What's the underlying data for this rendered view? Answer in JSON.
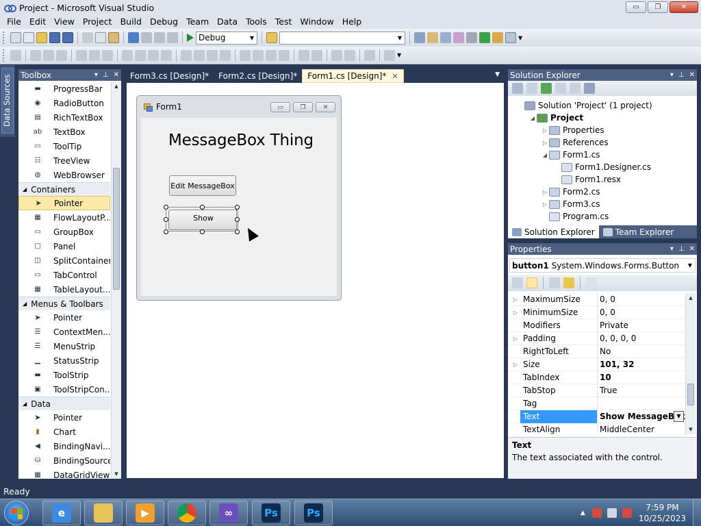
{
  "window": {
    "title": "Project - Microsoft Visual Studio",
    "minimize": "▭",
    "maximize": "❐",
    "close": "✕"
  },
  "menu": [
    "File",
    "Edit",
    "View",
    "Project",
    "Build",
    "Debug",
    "Team",
    "Data",
    "Tools",
    "Test",
    "Window",
    "Help"
  ],
  "toolbar": {
    "config_value": "Debug",
    "platform_value": ""
  },
  "side_strip": {
    "label": "Data Sources"
  },
  "toolbox": {
    "title": "Toolbox",
    "header_controls": [
      "▾",
      "⊥",
      "✕"
    ],
    "common_items_tail": [
      {
        "label": "ProgressBar",
        "icon": "progressbar-icon"
      },
      {
        "label": "RadioButton",
        "icon": "radiobutton-icon"
      },
      {
        "label": "RichTextBox",
        "icon": "richtextbox-icon"
      },
      {
        "label": "TextBox",
        "icon": "textbox-icon"
      },
      {
        "label": "ToolTip",
        "icon": "tooltip-icon"
      },
      {
        "label": "TreeView",
        "icon": "treeview-icon"
      },
      {
        "label": "WebBrowser",
        "icon": "webbrowser-icon"
      }
    ],
    "groups": [
      {
        "title": "Containers",
        "items": [
          {
            "label": "Pointer",
            "icon": "pointer-icon",
            "selected": true
          },
          {
            "label": "FlowLayoutP...",
            "icon": "flowlayoutpanel-icon"
          },
          {
            "label": "GroupBox",
            "icon": "groupbox-icon"
          },
          {
            "label": "Panel",
            "icon": "panel-icon"
          },
          {
            "label": "SplitContainer",
            "icon": "splitcontainer-icon"
          },
          {
            "label": "TabControl",
            "icon": "tabcontrol-icon"
          },
          {
            "label": "TableLayout...",
            "icon": "tablelayoutpanel-icon"
          }
        ]
      },
      {
        "title": "Menus & Toolbars",
        "items": [
          {
            "label": "Pointer",
            "icon": "pointer-icon"
          },
          {
            "label": "ContextMen...",
            "icon": "contextmenu-icon"
          },
          {
            "label": "MenuStrip",
            "icon": "menustrip-icon"
          },
          {
            "label": "StatusStrip",
            "icon": "statusstrip-icon"
          },
          {
            "label": "ToolStrip",
            "icon": "toolstrip-icon"
          },
          {
            "label": "ToolStripCon...",
            "icon": "toolstripcontainer-icon"
          }
        ]
      },
      {
        "title": "Data",
        "items": [
          {
            "label": "Pointer",
            "icon": "pointer-icon"
          },
          {
            "label": "Chart",
            "icon": "chart-icon"
          },
          {
            "label": "BindingNavi...",
            "icon": "bindingnavigator-icon"
          },
          {
            "label": "BindingSource",
            "icon": "bindingsource-icon"
          },
          {
            "label": "DataGridView",
            "icon": "datagridview-icon"
          }
        ]
      }
    ]
  },
  "doc_tabs": [
    {
      "label": "Form3.cs [Design]*",
      "active": false
    },
    {
      "label": "Form2.cs [Design]*",
      "active": false
    },
    {
      "label": "Form1.cs [Design]*",
      "active": true
    }
  ],
  "designer": {
    "form_title": "Form1",
    "heading": "MessageBox Thing",
    "edit_button": "Edit MessageBox",
    "show_button": "Show"
  },
  "solution_explorer": {
    "title": "Solution Explorer",
    "tree": [
      {
        "label": "Solution 'Project' (1 project)",
        "indent": 0,
        "exp": "",
        "bold": false,
        "icon": "solution-icon"
      },
      {
        "label": "Project",
        "indent": 1,
        "exp": "◢",
        "bold": true,
        "icon": "csharp-project-icon"
      },
      {
        "label": "Properties",
        "indent": 2,
        "exp": "▷",
        "bold": false,
        "icon": "properties-folder-icon"
      },
      {
        "label": "References",
        "indent": 2,
        "exp": "▷",
        "bold": false,
        "icon": "references-icon"
      },
      {
        "label": "Form1.cs",
        "indent": 2,
        "exp": "◢",
        "bold": false,
        "icon": "form-file-icon"
      },
      {
        "label": "Form1.Designer.cs",
        "indent": 3,
        "exp": "",
        "bold": false,
        "icon": "cs-file-icon"
      },
      {
        "label": "Form1.resx",
        "indent": 3,
        "exp": "",
        "bold": false,
        "icon": "resx-file-icon"
      },
      {
        "label": "Form2.cs",
        "indent": 2,
        "exp": "▷",
        "bold": false,
        "icon": "form-file-icon"
      },
      {
        "label": "Form3.cs",
        "indent": 2,
        "exp": "▷",
        "bold": false,
        "icon": "form-file-icon"
      },
      {
        "label": "Program.cs",
        "indent": 2,
        "exp": "",
        "bold": false,
        "icon": "cs-file-icon"
      }
    ],
    "tabs": [
      {
        "label": "Solution Explorer",
        "active": true
      },
      {
        "label": "Team Explorer",
        "active": false
      }
    ]
  },
  "properties": {
    "title": "Properties",
    "object_name": "button1",
    "object_type": "System.Windows.Forms.Button",
    "rows": [
      {
        "name": "MaximumSize",
        "value": "0, 0",
        "exp": "▷",
        "bold": false
      },
      {
        "name": "MinimumSize",
        "value": "0, 0",
        "exp": "▷",
        "bold": false
      },
      {
        "name": "Modifiers",
        "value": "Private",
        "exp": "",
        "bold": false
      },
      {
        "name": "Padding",
        "value": "0, 0, 0, 0",
        "exp": "▷",
        "bold": false
      },
      {
        "name": "RightToLeft",
        "value": "No",
        "exp": "",
        "bold": false
      },
      {
        "name": "Size",
        "value": "101, 32",
        "exp": "▷",
        "bold": true
      },
      {
        "name": "TabIndex",
        "value": "10",
        "exp": "",
        "bold": true
      },
      {
        "name": "TabStop",
        "value": "True",
        "exp": "",
        "bold": false
      },
      {
        "name": "Tag",
        "value": "",
        "exp": "",
        "bold": false
      },
      {
        "name": "Text",
        "value": "Show MessageBox",
        "exp": "",
        "bold": true,
        "selected": true
      },
      {
        "name": "TextAlign",
        "value": "MiddleCenter",
        "exp": "",
        "bold": false
      }
    ],
    "desc_title": "Text",
    "desc_text": "The text associated with the control."
  },
  "status": {
    "text": "Ready"
  },
  "taskbar": {
    "apps": [
      {
        "name": "internet-explorer-icon",
        "color": "#3c8be0",
        "glyph": "e"
      },
      {
        "name": "file-explorer-icon",
        "color": "#e8c35a",
        "glyph": ""
      },
      {
        "name": "media-player-icon",
        "color": "#f0a030",
        "glyph": "▶"
      },
      {
        "name": "chrome-icon",
        "color": "#db4437",
        "glyph": ""
      },
      {
        "name": "visual-studio-icon",
        "color": "#6b4fbb",
        "glyph": "∞"
      },
      {
        "name": "photoshop-icon",
        "color": "#0f2a4f",
        "glyph": "Ps"
      },
      {
        "name": "photoshop-icon",
        "color": "#0f2a4f",
        "glyph": "Ps"
      }
    ],
    "clock_time": "7:59 PM",
    "clock_date": "10/25/2023"
  }
}
